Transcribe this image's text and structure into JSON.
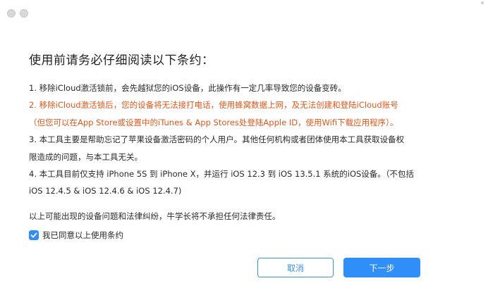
{
  "window": {
    "controls": [
      "close",
      "minimize"
    ]
  },
  "heading": "使用前请务必仔细阅读以下条约：",
  "terms": [
    {
      "text": "1. 移除iCloud激活锁前，会先越狱您的iOS设备，此操作有一定几率导致您的设备变砖。",
      "warning": false
    },
    {
      "text": "2. 移除iCloud激活锁后，您的设备将无法接打电话，使用蜂窝数据上网，及无法创建和登陆iCloud账号",
      "warning": true
    },
    {
      "text": "（但您可以在App Store或设置中的iTunes & App Stores处登陆Apple ID，使用Wifi下载应用程序）。",
      "warning": true
    },
    {
      "text": "3. 本工具主要是帮助忘记了苹果设备激活密码的个人用户。其他任何机构或者团体使用本工具获取设备权",
      "warning": false
    },
    {
      "text": "限造成的问题，与本工具无关。",
      "warning": false
    },
    {
      "text": "4. 本工具目前仅支持 iPhone 5S 到 iPhone X，并运行 iOS 12.3 到 iOS 13.5.1 系统的iOS设备。（不包括",
      "warning": false
    },
    {
      "text": "iOS 12.4.5 & iOS 12.4.6 & iOS 12.4.7)",
      "warning": false
    }
  ],
  "notice": "以上可能出现的设备问题和法律纠纷，牛学长将不承担任何法律责任。",
  "agree": {
    "label": "我已同意以上使用条约",
    "checked": true
  },
  "buttons": {
    "cancel": "取消",
    "next": "下一步"
  },
  "colors": {
    "accent": "#2f8ef7",
    "warning": "#e2571b"
  }
}
